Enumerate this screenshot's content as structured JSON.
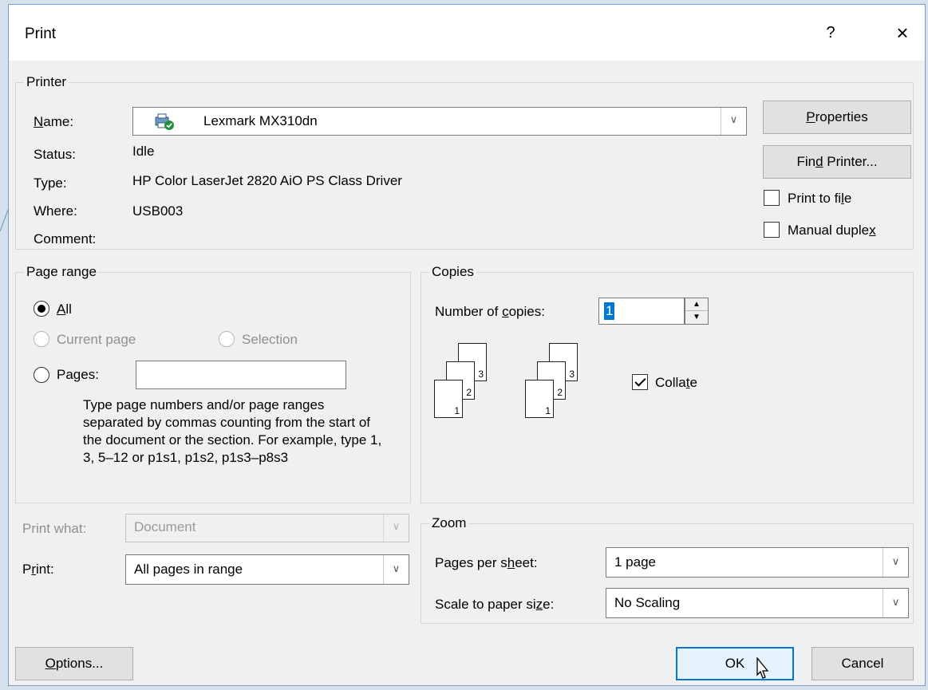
{
  "dialog": {
    "title": "Print",
    "help": "?",
    "close": "×"
  },
  "printer": {
    "group_label": "Printer",
    "name_label_pre": "",
    "name_label_u": "N",
    "name_label_post": "ame:",
    "name_value": "Lexmark MX310dn",
    "status_label": "Status:",
    "status_value": "Idle",
    "type_label": "Type:",
    "type_value": "HP Color LaserJet 2820 AiO PS Class Driver",
    "where_label": "Where:",
    "where_value": "USB003",
    "comment_label": "Comment:",
    "properties_pre": "",
    "properties_u": "P",
    "properties_post": "roperties",
    "find_pre": "Fin",
    "find_u": "d",
    "find_post": " Printer...",
    "print_to_file_pre": "Print to fi",
    "print_to_file_u": "l",
    "print_to_file_post": "e",
    "manual_duplex_pre": "Manual duple",
    "manual_duplex_u": "x",
    "manual_duplex_post": ""
  },
  "page_range": {
    "group_label": "Page range",
    "all_pre": "",
    "all_u": "A",
    "all_post": "ll",
    "current_page": "Current page",
    "selection": "Selection",
    "pages_pre": "Pa",
    "pages_u": "g",
    "pages_post": "es:",
    "pages_value": "",
    "help": "Type page numbers and/or page ranges separated by commas counting from the start of the document or the section. For example, type 1, 3, 5–12 or p1s1, p1s2, p1s3–p8s3"
  },
  "copies": {
    "group_label": "Copies",
    "number_pre": "Number of ",
    "number_u": "c",
    "number_post": "opies:",
    "number_value": "1",
    "collate_pre": "Colla",
    "collate_u": "t",
    "collate_post": "e",
    "collate_checked": true,
    "page_labels": [
      "3",
      "2",
      "1"
    ]
  },
  "print_what": {
    "label": "Print what:",
    "value": "Document"
  },
  "print": {
    "label_pre": "P",
    "label_u": "r",
    "label_post": "int:",
    "value": "All pages in range"
  },
  "zoom": {
    "group_label": "Zoom",
    "pages_per_sheet_pre": "Pages per s",
    "pages_per_sheet_u": "h",
    "pages_per_sheet_post": "eet:",
    "pages_per_sheet_value": "1 page",
    "scale_pre": "Scale to paper si",
    "scale_u": "z",
    "scale_post": "e:",
    "scale_value": "No Scaling"
  },
  "buttons": {
    "options_pre": "",
    "options_u": "O",
    "options_post": "ptions...",
    "ok": "OK",
    "cancel": "Cancel"
  },
  "icons": {
    "printer": "printer-ready-icon",
    "dropdown": "chevron-down-icon"
  },
  "colors": {
    "accent": "#0078d7",
    "ready_badge": "#1e8f3c"
  }
}
